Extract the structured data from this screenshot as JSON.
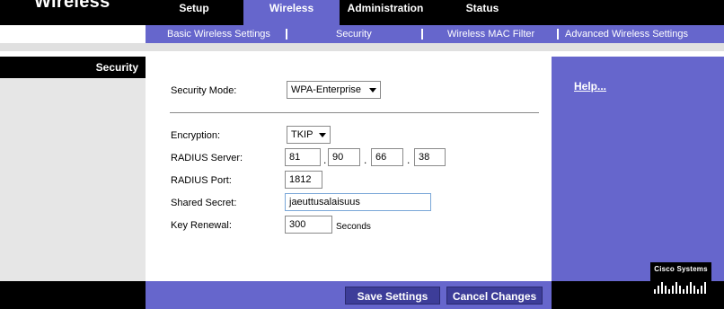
{
  "header": {
    "section_title": "Wireless",
    "tabs": [
      {
        "label": "Setup",
        "active": false
      },
      {
        "label": "Wireless",
        "active": true
      },
      {
        "label": "Administration",
        "active": false
      },
      {
        "label": "Status",
        "active": false
      }
    ]
  },
  "subnav": {
    "items": [
      {
        "label": "Basic Wireless Settings"
      },
      {
        "label": "Security"
      },
      {
        "label": "Wireless MAC Filter"
      },
      {
        "label": "Advanced Wireless Settings"
      }
    ]
  },
  "sidebar": {
    "section_label": "Security"
  },
  "form": {
    "security_mode": {
      "label": "Security Mode:",
      "value": "WPA-Enterprise"
    },
    "encryption": {
      "label": "Encryption:",
      "value": "TKIP"
    },
    "radius_server": {
      "label": "RADIUS Server:",
      "octets": [
        "81",
        "90",
        "66",
        "38"
      ],
      "separator": "."
    },
    "radius_port": {
      "label": "RADIUS Port:",
      "value": "1812"
    },
    "shared_secret": {
      "label": "Shared Secret:",
      "value": "jaeuttusalaisuus"
    },
    "key_renewal": {
      "label": "Key Renewal:",
      "value": "300",
      "unit": "Seconds"
    }
  },
  "help": {
    "label": "Help..."
  },
  "footer": {
    "save_label": "Save Settings",
    "cancel_label": "Cancel Changes"
  },
  "brand": {
    "logo_text": "Cisco Systems"
  },
  "colors": {
    "accent": "#6666cc",
    "header": "#000000",
    "button": "#3d3d99"
  }
}
